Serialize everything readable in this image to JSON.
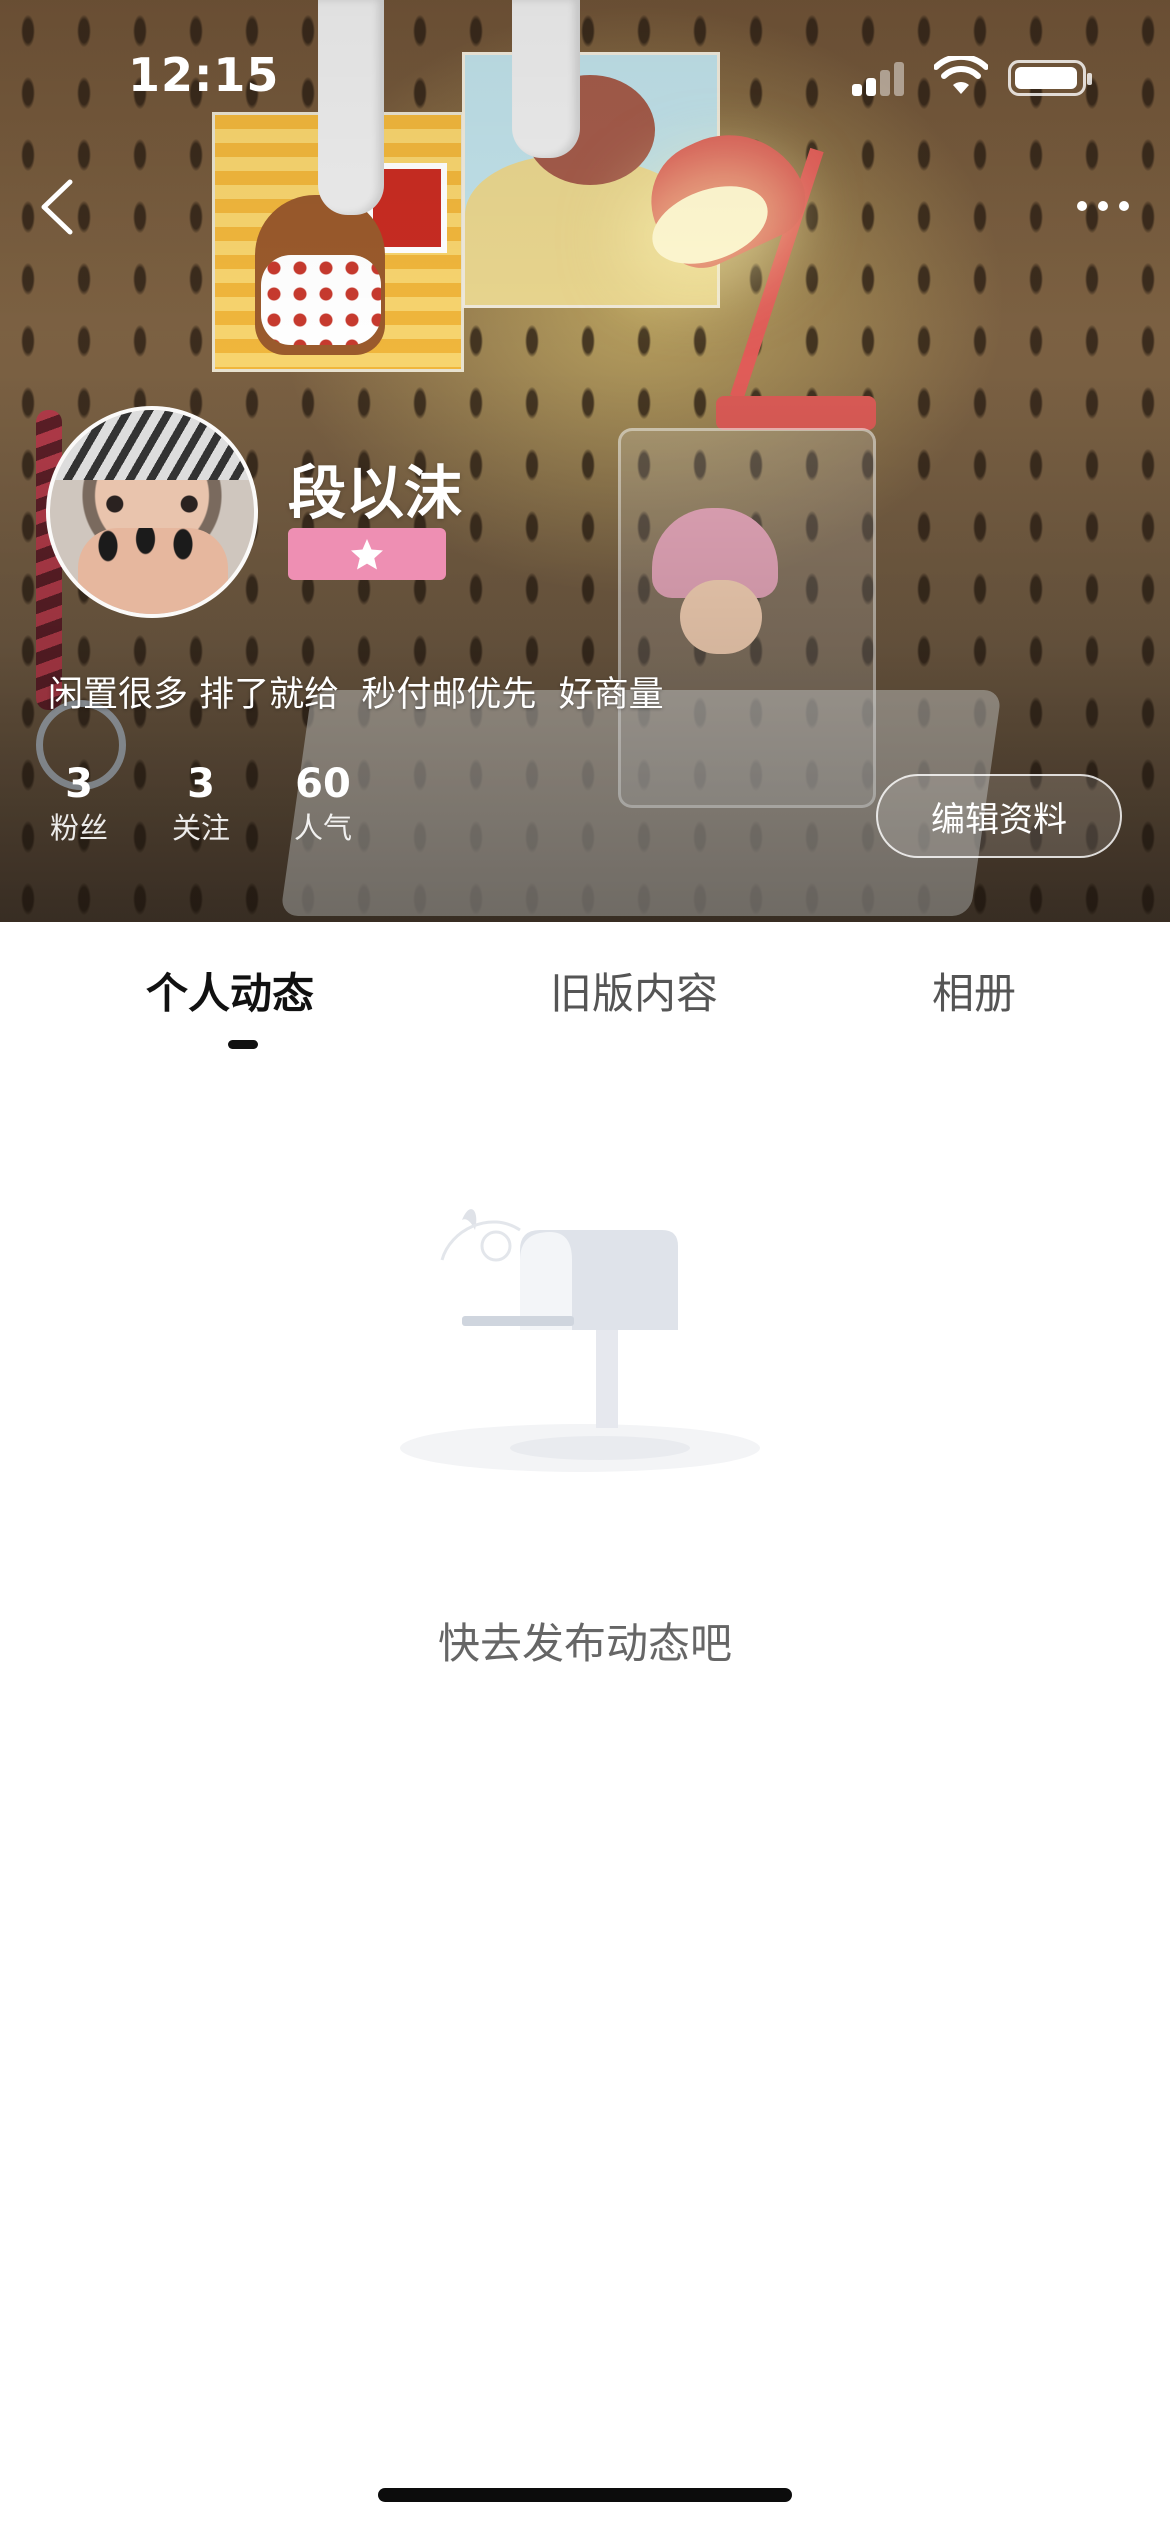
{
  "status_bar": {
    "time": "12:15",
    "icons": [
      "cellular-signal-icon",
      "wifi-icon",
      "battery-icon"
    ]
  },
  "nav": {
    "back_icon": "chevron-left-icon",
    "more_icon": "more-horizontal-icon"
  },
  "profile": {
    "name": "段以沫",
    "badge_icon": "star-icon",
    "badge_color": "#ee8fb3",
    "bio": "闲置很多 排了就给  秒付邮优先  好商量",
    "stats": [
      {
        "value": "3",
        "label": "粉丝"
      },
      {
        "value": "3",
        "label": "关注"
      },
      {
        "value": "60",
        "label": "人气"
      }
    ],
    "edit_button_label": "编辑资料"
  },
  "tabs": [
    {
      "label": "个人动态",
      "active": true
    },
    {
      "label": "旧版内容",
      "active": false
    },
    {
      "label": "相册",
      "active": false
    }
  ],
  "empty_state": {
    "icon": "mailbox-icon",
    "message": "快去发布动态吧"
  }
}
